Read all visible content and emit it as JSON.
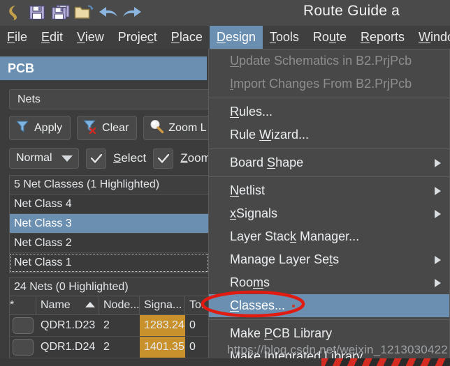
{
  "window": {
    "title": "Route Guide a",
    "toolbar_icons": [
      "altium-logo-icon",
      "save-icon",
      "save-all-icon",
      "open-folder-icon",
      "undo-icon",
      "redo-icon"
    ]
  },
  "menubar": {
    "items": [
      {
        "label": "File",
        "mnemonic": "F",
        "active": false
      },
      {
        "label": "Edit",
        "mnemonic": "E",
        "active": false
      },
      {
        "label": "View",
        "mnemonic": "V",
        "active": false
      },
      {
        "label": "Project",
        "mnemonic": "c",
        "active": false
      },
      {
        "label": "Place",
        "mnemonic": "P",
        "active": false
      },
      {
        "label": "Design",
        "mnemonic": "D",
        "active": true
      },
      {
        "label": "Tools",
        "mnemonic": "T",
        "active": false
      },
      {
        "label": "Route",
        "mnemonic": "u",
        "active": false
      },
      {
        "label": "Reports",
        "mnemonic": "R",
        "active": false
      },
      {
        "label": "Window",
        "mnemonic": "W",
        "active": false
      }
    ]
  },
  "pcb_panel": {
    "header": "PCB",
    "object_combo": {
      "value": "Nets",
      "placeholder": "Nets"
    },
    "buttons": [
      {
        "label": "Apply",
        "icon": "filter-apply-icon"
      },
      {
        "label": "Clear",
        "icon": "filter-clear-icon"
      },
      {
        "label": "Zoom L",
        "icon": "magnifier-icon"
      }
    ],
    "mode_dropdown": {
      "value": "Normal"
    },
    "checkboxes": [
      {
        "label": "Select",
        "mnemonic": "S",
        "checked": true
      },
      {
        "label": "Zoom",
        "mnemonic": "Z",
        "checked": true
      }
    ],
    "net_classes": {
      "title": "5 Net Classes (1 Highlighted)",
      "rows": [
        {
          "label": "Net Class 4",
          "selected": false,
          "focused": false
        },
        {
          "label": "Net Class 3",
          "selected": true,
          "focused": false
        },
        {
          "label": "Net Class 2",
          "selected": false,
          "focused": false
        },
        {
          "label": "Net Class 1",
          "selected": false,
          "focused": true
        }
      ]
    },
    "nets": {
      "title": "24 Nets (0 Highlighted)",
      "columns": [
        "*",
        "Name",
        "Node...",
        "Signa...",
        "Tot"
      ],
      "sorted_column": "Name",
      "sort_direction": "ascending",
      "rows": [
        {
          "star": "",
          "name": "QDR1.D23",
          "nodes": "2",
          "signal": "1283.24",
          "total": "0"
        },
        {
          "star": "",
          "name": "QDR1.D24",
          "nodes": "2",
          "signal": "1401.35",
          "total": "0"
        }
      ]
    }
  },
  "design_menu": {
    "items": [
      {
        "label": "Update Schematics in B2.PrjPcb",
        "mnemonic": "U",
        "disabled": true,
        "submenu": false,
        "selected": false
      },
      {
        "label": "Import Changes From B2.PrjPcb",
        "mnemonic": "I",
        "disabled": true,
        "submenu": false,
        "selected": false
      },
      {
        "separator": true
      },
      {
        "label": "Rules...",
        "mnemonic": "R",
        "disabled": false,
        "submenu": false,
        "selected": false
      },
      {
        "label": "Rule Wizard...",
        "mnemonic": "W",
        "disabled": false,
        "submenu": false,
        "selected": false
      },
      {
        "separator": true
      },
      {
        "label": "Board Shape",
        "mnemonic": "S",
        "disabled": false,
        "submenu": true,
        "selected": false
      },
      {
        "separator": true
      },
      {
        "label": "Netlist",
        "mnemonic": "N",
        "disabled": false,
        "submenu": true,
        "selected": false
      },
      {
        "label": "xSignals",
        "mnemonic": "x",
        "disabled": false,
        "submenu": true,
        "selected": false
      },
      {
        "label": "Layer Stack Manager...",
        "mnemonic": "k",
        "disabled": false,
        "submenu": false,
        "selected": false
      },
      {
        "label": "Manage Layer Sets",
        "mnemonic": "t",
        "disabled": false,
        "submenu": true,
        "selected": false
      },
      {
        "label": "Rooms",
        "mnemonic": "m",
        "disabled": false,
        "submenu": true,
        "selected": false
      },
      {
        "label": "Classes...",
        "mnemonic": "C",
        "disabled": false,
        "submenu": false,
        "selected": true
      },
      {
        "separator": true
      },
      {
        "label": "Make PCB Library",
        "mnemonic": "P",
        "disabled": false,
        "submenu": false,
        "selected": false
      },
      {
        "label": "Make Integrated Library",
        "mnemonic": "a",
        "disabled": false,
        "submenu": false,
        "selected": false
      }
    ]
  },
  "annotation": {
    "shape": "red-ellipse",
    "color": "#e01b12",
    "targets": "Classes..."
  },
  "watermark": {
    "text": "https://blog.csdn.net/weixin_1213030422"
  },
  "colors": {
    "accent": "#6a8fb0",
    "panel_bg": "#3c3c3c",
    "menu_bg": "#484848",
    "titlebar_bg": "#4a4a4a",
    "signal_cell": "#c8912c",
    "annotation_red": "#e01b12"
  }
}
